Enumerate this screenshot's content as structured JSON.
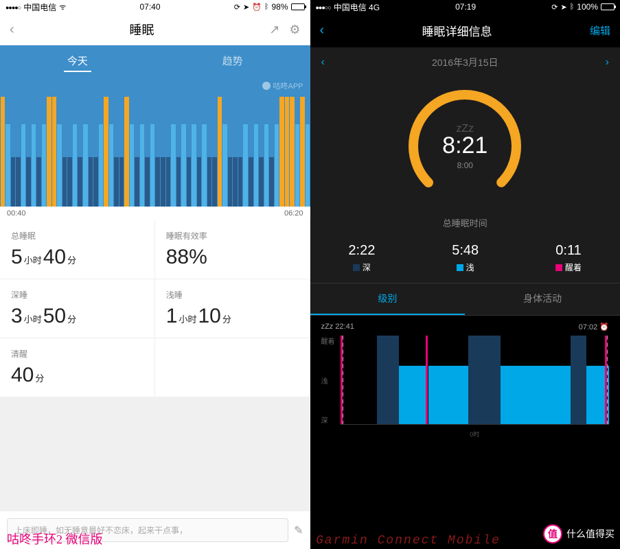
{
  "left": {
    "status": {
      "carrier": "中国电信",
      "time": "07:40",
      "battery": "98%"
    },
    "nav": {
      "title": "睡眠"
    },
    "tabs": {
      "active": "今天",
      "inactive": "趋势"
    },
    "watermark": "咕咚APP",
    "time_axis": {
      "start": "00:40",
      "end": "06:20"
    },
    "stats": {
      "total_label": "总睡眠",
      "total_h": "5",
      "total_h_unit": "小时",
      "total_m": "40",
      "total_m_unit": "分",
      "eff_label": "睡眠有效率",
      "eff_value": "88%",
      "deep_label": "深睡",
      "deep_h": "3",
      "deep_h_unit": "小时",
      "deep_m": "50",
      "deep_m_unit": "分",
      "light_label": "浅睡",
      "light_h": "1",
      "light_h_unit": "小时",
      "light_m": "10",
      "light_m_unit": "分",
      "awake_label": "清醒",
      "awake_m": "40",
      "awake_m_unit": "分"
    },
    "input_placeholder": "上床即睡，如无睡意最好不恋床，起来干点事，",
    "caption": "咕咚手环2  微信版"
  },
  "right": {
    "status": {
      "carrier": "中国电信  4G",
      "time": "07:19",
      "battery": "100%"
    },
    "nav": {
      "title": "睡眠详细信息",
      "edit": "编辑"
    },
    "date": "2016年3月15日",
    "donut": {
      "zzz": "zZz",
      "main": "8:21",
      "sub": "8:00"
    },
    "donut_label": "总睡眠时间",
    "breakdown": {
      "deep_time": "2:22",
      "deep_label": "深",
      "light_time": "5:48",
      "light_label": "浅",
      "awake_time": "0:11",
      "awake_label": "醒着"
    },
    "tabs": {
      "active": "级别",
      "inactive": "身体活动"
    },
    "timeline": {
      "start_label": "22:41",
      "end_label": "07:02",
      "y_labels": [
        "醒着",
        "浅",
        "深"
      ],
      "x_labels": [
        "0时"
      ]
    },
    "caption": "Garmin  Connect  Mobile"
  },
  "corner_watermark": {
    "badge": "值",
    "text": "什么值得买"
  },
  "chart_data": {
    "left_sleep_bars": {
      "type": "bar",
      "xlabel": "time",
      "ylabel": "sleep state height (%)",
      "x_range": [
        "00:40",
        "06:20"
      ],
      "categories_note": "~60 minute-slices; state: awake/light/deep",
      "series": [
        {
          "name": "state",
          "values": [
            "awake",
            "light",
            "deep",
            "deep",
            "light",
            "deep",
            "light",
            "deep",
            "light",
            "awake",
            "awake",
            "light",
            "deep",
            "deep",
            "light",
            "deep",
            "light",
            "deep",
            "deep",
            "light",
            "awake",
            "light",
            "deep",
            "deep",
            "awake",
            "light",
            "deep",
            "light",
            "deep",
            "light",
            "deep",
            "deep",
            "deep",
            "light",
            "deep",
            "light",
            "deep",
            "light",
            "deep",
            "light",
            "deep",
            "deep",
            "awake",
            "light",
            "deep",
            "deep",
            "deep",
            "light",
            "deep",
            "light",
            "deep",
            "light",
            "deep",
            "light",
            "awake",
            "awake",
            "awake",
            "light",
            "awake",
            "light"
          ]
        }
      ]
    },
    "right_donut": {
      "type": "pie",
      "title": "总睡眠时间",
      "actual": "8:21",
      "goal": "8:00",
      "progress_ratio": 1.04
    },
    "right_breakdown": {
      "type": "bar",
      "categories": [
        "深",
        "浅",
        "醒着"
      ],
      "values_minutes": [
        142,
        348,
        11
      ]
    },
    "right_timeline": {
      "type": "area",
      "x_range": [
        "22:41",
        "07:02"
      ],
      "ylabels": [
        "深",
        "浅",
        "醒着"
      ],
      "segments": [
        {
          "start": "22:41",
          "end": "22:44",
          "state": "awake"
        },
        {
          "start": "22:44",
          "end": "23:50",
          "state": "none"
        },
        {
          "start": "23:50",
          "end": "00:30",
          "state": "deep"
        },
        {
          "start": "00:30",
          "end": "01:20",
          "state": "light"
        },
        {
          "start": "01:20",
          "end": "01:25",
          "state": "awake"
        },
        {
          "start": "01:25",
          "end": "02:40",
          "state": "light"
        },
        {
          "start": "02:40",
          "end": "03:40",
          "state": "deep"
        },
        {
          "start": "03:40",
          "end": "05:50",
          "state": "light"
        },
        {
          "start": "05:50",
          "end": "06:20",
          "state": "deep"
        },
        {
          "start": "06:20",
          "end": "06:55",
          "state": "light"
        },
        {
          "start": "06:55",
          "end": "07:00",
          "state": "awake"
        },
        {
          "start": "07:00",
          "end": "07:02",
          "state": "light"
        }
      ]
    }
  }
}
